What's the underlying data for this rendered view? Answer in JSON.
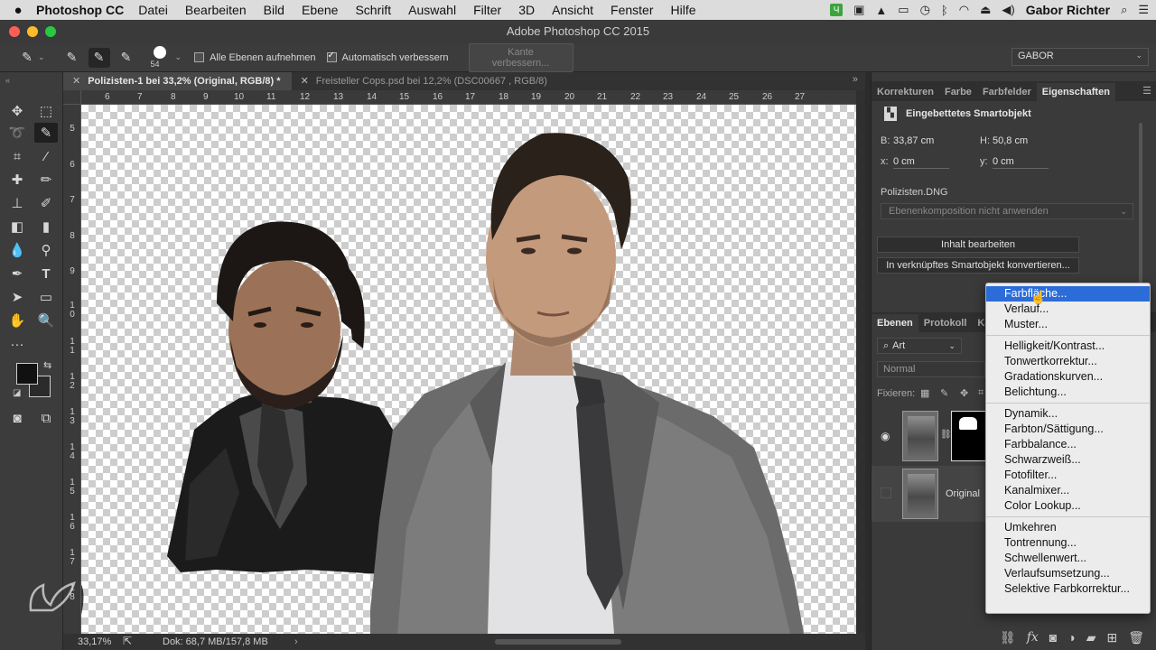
{
  "menubar": {
    "apple": "",
    "app": "Photoshop CC",
    "items": [
      "Datei",
      "Bearbeiten",
      "Bild",
      "Ebene",
      "Schrift",
      "Auswahl",
      "Filter",
      "3D",
      "Ansicht",
      "Fenster",
      "Hilfe"
    ],
    "user": "Gabor Richter"
  },
  "window": {
    "title": "Adobe Photoshop CC 2015"
  },
  "options": {
    "brush_size": "54",
    "sample_all_layers": "Alle Ebenen aufnehmen",
    "auto_enhance": "Automatisch verbessern",
    "refine_edge": "Kante verbessern...",
    "workspace": "GABOR"
  },
  "tabs": [
    {
      "label": "Polizisten-1 bei 33,2% (Original, RGB/8) *",
      "active": true
    },
    {
      "label": "Freisteller Cops.psd bei 12,2% (DSC00667 , RGB/8)",
      "active": false
    }
  ],
  "ruler": {
    "h": [
      "6",
      "7",
      "8",
      "9",
      "10",
      "11",
      "12",
      "13",
      "14",
      "15",
      "16",
      "17",
      "18",
      "19",
      "20",
      "21",
      "22",
      "23",
      "24",
      "25",
      "26",
      "27"
    ],
    "v": [
      "5",
      "6",
      "7",
      "8",
      "9",
      "1 0",
      "1 1",
      "1 2",
      "1 3",
      "1 4",
      "1 5",
      "1 6",
      "1 7",
      "1 8"
    ]
  },
  "status": {
    "zoom": "33,17%",
    "doc": "Dok: 68,7 MB/157,8 MB"
  },
  "properties": {
    "tabs": [
      "Korrekturen",
      "Farbe",
      "Farbfelder",
      "Eigenschaften"
    ],
    "active_tab": "Eigenschaften",
    "title": "Eingebettetes Smartobjekt",
    "width_label": "B:",
    "width": "33,87 cm",
    "height_label": "H:",
    "height": "50,8 cm",
    "x_label": "x:",
    "x": "0 cm",
    "y_label": "y:",
    "y": "0 cm",
    "file": "Polizisten.DNG",
    "layer_comp": "Ebenenkomposition nicht anwenden",
    "edit_btn": "Inhalt bearbeiten",
    "convert_btn": "In verknüpftes Smartobjekt konvertieren..."
  },
  "layers": {
    "tabs": [
      "Ebenen",
      "Protokoll",
      "Ka"
    ],
    "filter": "Art",
    "blend": "Normal",
    "lock_label": "Fixieren:",
    "layer_name": "Original"
  },
  "adjust_menu": {
    "groups": [
      [
        "Farbfläche...",
        "Verlauf...",
        "Muster..."
      ],
      [
        "Helligkeit/Kontrast...",
        "Tonwertkorrektur...",
        "Gradationskurven...",
        "Belichtung..."
      ],
      [
        "Dynamik...",
        "Farbton/Sättigung...",
        "Farbbalance...",
        "Schwarzweiß...",
        "Fotofilter...",
        "Kanalmixer...",
        "Color Lookup..."
      ],
      [
        "Umkehren",
        "Tontrennung...",
        "Schwellenwert...",
        "Verlaufsumsetzung...",
        "Selektive Farbkorrektur..."
      ]
    ],
    "highlighted": "Farbfläche..."
  }
}
